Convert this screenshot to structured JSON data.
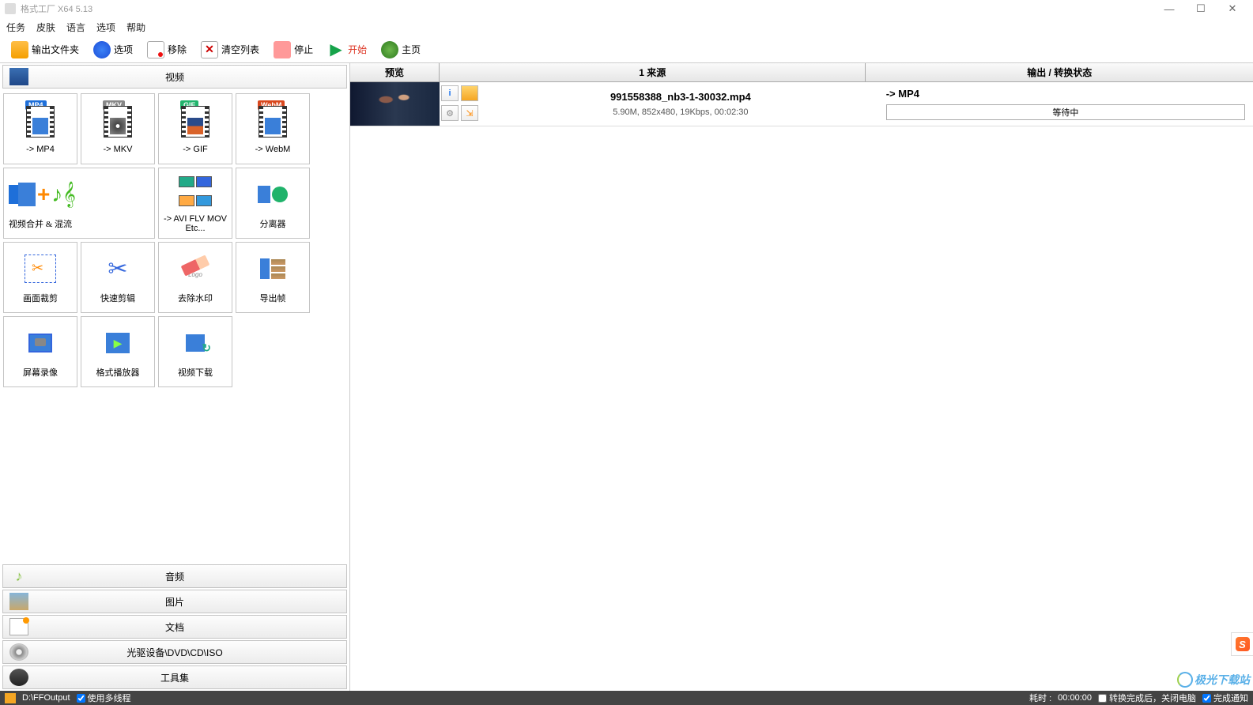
{
  "window": {
    "title": "格式工厂 X64 5.13"
  },
  "menu": {
    "task": "任务",
    "skin": "皮肤",
    "language": "语言",
    "options": "选项",
    "help": "帮助"
  },
  "toolbar": {
    "output_folder": "输出文件夹",
    "options": "选项",
    "remove": "移除",
    "clear_list": "清空列表",
    "stop": "停止",
    "start": "开始",
    "home": "主页"
  },
  "categories": {
    "video": "视频",
    "audio": "音频",
    "image": "图片",
    "document": "文档",
    "disc": "光驱设备\\DVD\\CD\\ISO",
    "toolset": "工具集"
  },
  "tiles": {
    "mp4": "-> MP4",
    "mkv": "-> MKV",
    "gif": "-> GIF",
    "webm": "-> WebM",
    "merge": "视频合并 & 混流",
    "avi": "-> AVI FLV MOV Etc...",
    "splitter": "分离器",
    "crop": "画面裁剪",
    "quickcut": "快速剪辑",
    "dewatermark": "去除水印",
    "exportframe": "导出帧",
    "screenrec": "屏幕录像",
    "player": "格式播放器",
    "download": "视频下载"
  },
  "grid": {
    "headers": {
      "preview": "预览",
      "source": "1 来源",
      "status": "输出 / 转换状态"
    }
  },
  "task": {
    "filename": "991558388_nb3-1-30032.mp4",
    "info": "5.90M, 852x480, 19Kbps, 00:02:30",
    "output": "-> MP4",
    "progress_text": "等待中"
  },
  "statusbar": {
    "output_path": "D:\\FFOutput",
    "multithread": "使用多线程",
    "elapsed_label": "耗时 : ",
    "elapsed_time": "00:00:00",
    "shutdown": "转换完成后，关闭电脑",
    "notify": "完成通知"
  },
  "watermark": {
    "text": "极光下载站"
  },
  "icons": {
    "mp4_badge": "MP4",
    "mkv_badge": "MKV",
    "gif_badge": "GIF",
    "webm_badge": "WebM",
    "logo_text": "Logo",
    "sogou_s": "S"
  }
}
